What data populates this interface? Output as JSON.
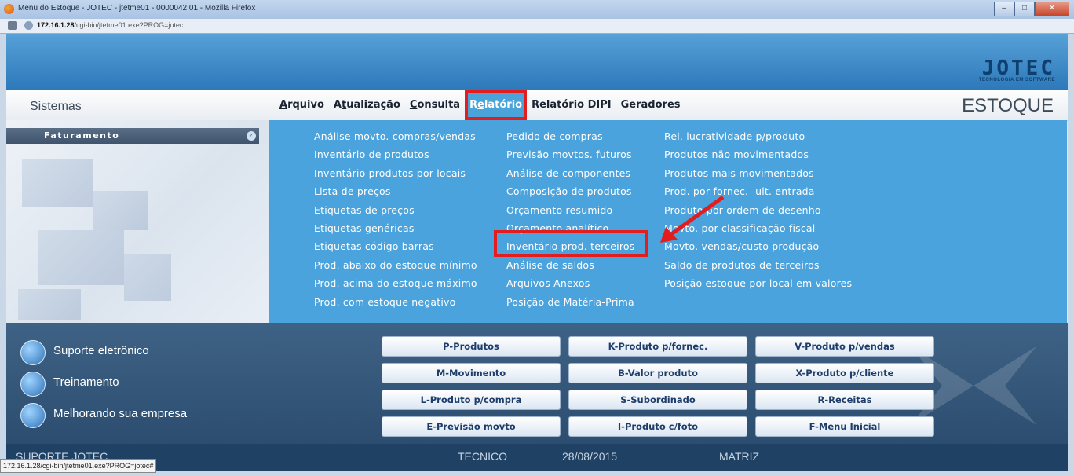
{
  "window": {
    "title": "Menu do Estoque - JOTEC - jtetme01 - 0000042.01 - Mozilla Firefox",
    "url_host": "172.16.1.28",
    "url_path": "/cgi-bin/jtetme01.exe?PROG=jotec",
    "min_label": "–",
    "max_label": "□",
    "close_label": "✕"
  },
  "brand": {
    "name": "JOTEC",
    "tagline": "TECNOLOGIA EM SOFTWARE"
  },
  "header": {
    "sistemas_label": "Sistemas",
    "module_name": "ESTOQUE"
  },
  "menus": [
    {
      "label": "Arquivo",
      "active": false
    },
    {
      "label": "Atualização",
      "active": false
    },
    {
      "label": "Consulta",
      "active": false
    },
    {
      "label": "Relatório",
      "active": true
    },
    {
      "label": "Relatório DIPI",
      "active": false
    },
    {
      "label": "Geradores",
      "active": false
    }
  ],
  "sidebar": {
    "item": "Faturamento"
  },
  "relatorio_menu": {
    "col1": [
      "Análise movto. compras/vendas",
      "Inventário de produtos",
      "Inventário produtos por locais",
      "Lista de preços",
      "Etiquetas de preços",
      "Etiquetas genéricas",
      "Etiquetas código barras",
      "Prod. abaixo do estoque mínimo",
      "Prod. acima do estoque máximo",
      "Prod. com estoque negativo"
    ],
    "col2": [
      "Pedido de compras",
      "Previsão movtos. futuros",
      "Análise de componentes",
      "Composição de produtos",
      "Orçamento resumido",
      "Orçamento analítico",
      "Inventário prod. terceiros",
      "Análise de saldos",
      "Arquivos Anexos",
      "Posição de Matéria-Prima"
    ],
    "col3": [
      "Rel. lucratividade p/produto",
      "Produtos não movimentados",
      "Produtos mais movimentados",
      "Prod. por fornec.- ult. entrada",
      "Produto por ordem de desenho",
      "Movto. por classificação fiscal",
      "Movto. vendas/custo produção",
      "Saldo de produtos de terceiros",
      "Posição estoque por local em valores"
    ],
    "highlighted": "Inventário prod. terceiros",
    "highlight_color": "#e31d1d"
  },
  "support_links": [
    {
      "label": "Suporte eletrônico",
      "icon": "question-icon"
    },
    {
      "label": "Treinamento",
      "icon": "training-icon"
    },
    {
      "label": "Melhorando sua empresa",
      "icon": "chart-growth-icon"
    }
  ],
  "shortcuts": [
    "P-Produtos",
    "K-Produto p/fornec.",
    "V-Produto p/vendas",
    "M-Movimento",
    "B-Valor produto",
    "X-Produto p/cliente",
    "L-Produto p/compra",
    "S-Subordinado",
    "R-Receitas",
    "E-Previsão movto",
    "I-Produto c/foto",
    "F-Menu Inicial"
  ],
  "statusbar": {
    "left": "SUPORTE JOTEC",
    "user": "TECNICO",
    "date": "28/08/2015",
    "branch": "MATRIZ"
  },
  "tooltip": "172.16.1.28/cgi-bin/jtetme01.exe?PROG=jotec#"
}
